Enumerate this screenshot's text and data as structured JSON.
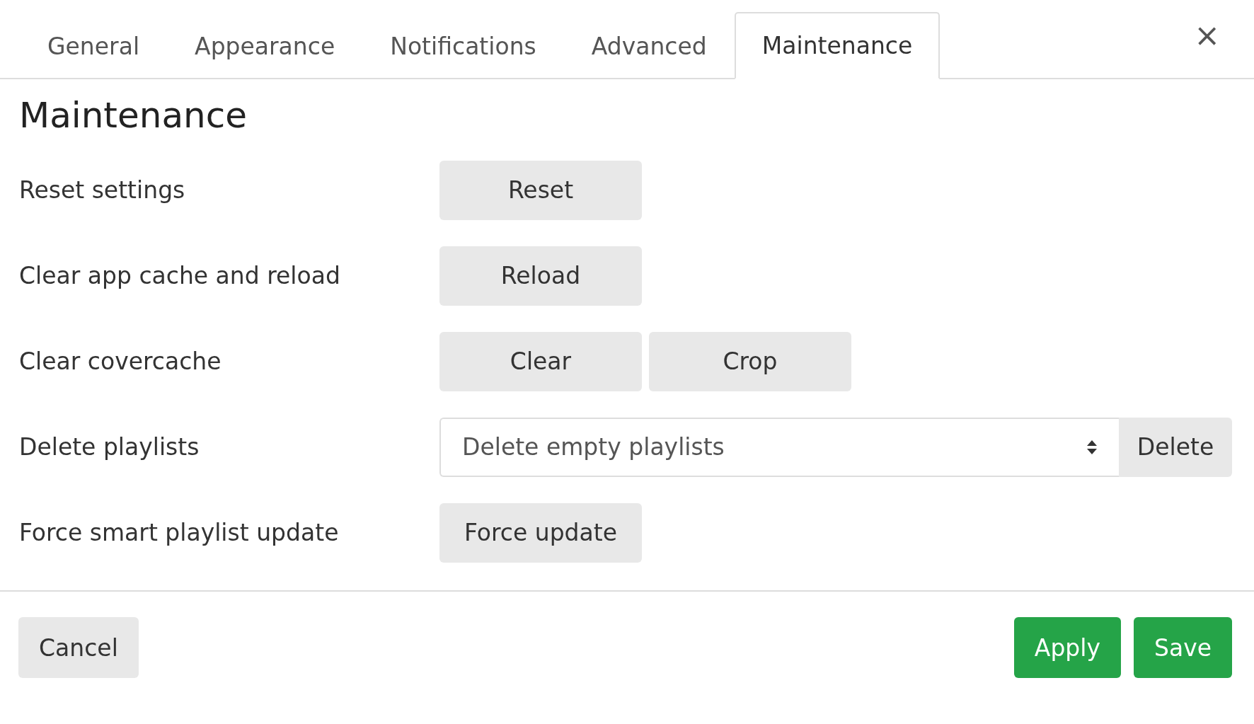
{
  "tabs": [
    {
      "label": "General",
      "selected": false
    },
    {
      "label": "Appearance",
      "selected": false
    },
    {
      "label": "Notifications",
      "selected": false
    },
    {
      "label": "Advanced",
      "selected": false
    },
    {
      "label": "Maintenance",
      "selected": true
    }
  ],
  "close": "×",
  "heading": "Maintenance",
  "rows": [
    {
      "label": "Reset settings",
      "kind": "buttons",
      "buttons": [
        "Reset"
      ]
    },
    {
      "label": "Clear app cache and reload",
      "kind": "buttons",
      "buttons": [
        "Reload"
      ]
    },
    {
      "label": "Clear covercache",
      "kind": "buttons",
      "buttons": [
        "Clear",
        "Crop"
      ]
    },
    {
      "label": "Delete playlists",
      "kind": "select",
      "value": "Delete empty playlists",
      "button": "Delete"
    },
    {
      "label": "Force smart playlist update",
      "kind": "buttons",
      "buttons": [
        "Force update"
      ]
    }
  ],
  "footer": [
    {
      "label": "Cancel",
      "kind": "secondary"
    },
    {
      "label": "Apply",
      "kind": "primary"
    },
    {
      "label": "Save",
      "kind": "primary"
    }
  ]
}
